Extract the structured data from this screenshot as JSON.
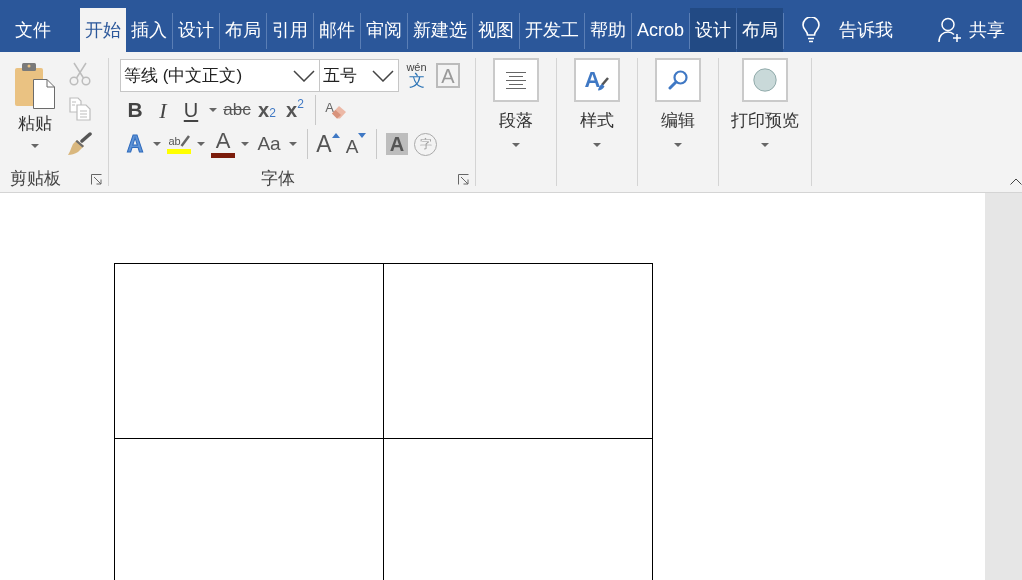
{
  "tabs": [
    {
      "label": "文件",
      "selected": false,
      "contextual": false
    },
    {
      "label": "开始",
      "selected": true,
      "contextual": false
    },
    {
      "label": "插入",
      "selected": false,
      "contextual": false
    },
    {
      "label": "设计",
      "selected": false,
      "contextual": false
    },
    {
      "label": "布局",
      "selected": false,
      "contextual": false
    },
    {
      "label": "引用",
      "selected": false,
      "contextual": false
    },
    {
      "label": "邮件",
      "selected": false,
      "contextual": false
    },
    {
      "label": "审阅",
      "selected": false,
      "contextual": false
    },
    {
      "label": "新建选",
      "selected": false,
      "contextual": false
    },
    {
      "label": "视图",
      "selected": false,
      "contextual": false
    },
    {
      "label": "开发工",
      "selected": false,
      "contextual": false
    },
    {
      "label": "帮助",
      "selected": false,
      "contextual": false
    },
    {
      "label": "Acrob",
      "selected": false,
      "contextual": false
    },
    {
      "label": "设计",
      "selected": false,
      "contextual": true
    },
    {
      "label": "布局",
      "selected": false,
      "contextual": true
    }
  ],
  "tell_me": {
    "label": "告诉我"
  },
  "share": {
    "label": "共享"
  },
  "clipboard": {
    "title": "剪贴板",
    "paste": {
      "label": "粘贴"
    },
    "tools": [
      {
        "kind": "cut",
        "disabled": true
      },
      {
        "kind": "copy",
        "disabled": true
      },
      {
        "kind": "format_painter",
        "disabled": false
      }
    ]
  },
  "font": {
    "title": "字体",
    "font_name": {
      "value": "等线 (中文正文)"
    },
    "font_size": {
      "value": "五号"
    },
    "phonetic_guide": {
      "reading": "wén",
      "character": "文"
    },
    "character_border": {
      "glyph": "A"
    },
    "rows": [
      [
        [
          {
            "kind": "bold",
            "glyph": "B",
            "dropdown": false
          },
          {
            "kind": "italic",
            "glyph": "I",
            "dropdown": false
          },
          {
            "kind": "underline",
            "glyph": "U",
            "dropdown": true
          },
          {
            "kind": "strikethrough",
            "glyph": "abc",
            "dropdown": false
          },
          {
            "kind": "subscript",
            "glyph": "x$_{2}$",
            "dropdown": false
          },
          {
            "kind": "superscript",
            "glyph": "x$^{2}$",
            "dropdown": false
          }
        ],
        [
          {
            "kind": "clear_formatting",
            "glyph": "A",
            "dropdown": false
          }
        ]
      ],
      [
        [
          {
            "kind": "text_effects",
            "glyph": "A",
            "dropdown": true
          },
          {
            "kind": "highlight",
            "glyph": "ab",
            "dropdown": true,
            "color": "#ffff00"
          },
          {
            "kind": "font_color",
            "glyph": "A",
            "dropdown": true,
            "color": "#7b1c0b"
          },
          {
            "kind": "change_case",
            "glyph": "Aa",
            "dropdown": true
          }
        ],
        [
          {
            "kind": "grow_font",
            "glyph": "A",
            "dropdown": false
          },
          {
            "kind": "shrink_font",
            "glyph": "A",
            "dropdown": false
          }
        ],
        [
          {
            "kind": "character_shading",
            "glyph": "A",
            "dropdown": false
          },
          {
            "kind": "enclose_character",
            "glyph": "字",
            "dropdown": false
          }
        ]
      ]
    ]
  },
  "collapsed_groups": [
    {
      "kind": "paragraph",
      "label": "段落"
    },
    {
      "kind": "styles",
      "label": "样式",
      "glyph": "A"
    },
    {
      "kind": "editing",
      "label": "编辑"
    },
    {
      "kind": "print_preview",
      "label": "打印预览"
    }
  ]
}
